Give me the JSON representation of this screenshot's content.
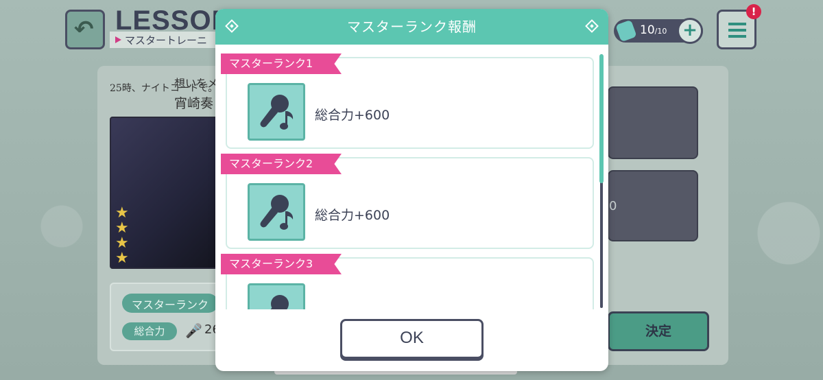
{
  "background": {
    "title": "LESSON",
    "subtitle": "マスタートレーニ",
    "stamina": {
      "current": "10",
      "max": "/10"
    },
    "menu_badge": "!",
    "card": {
      "unit_logo": "25時、ナイトコードで。",
      "title": "想いをメ",
      "character_name": "宵崎奏"
    },
    "master_rank_pill": "マスターランク",
    "power_pill": "総合力",
    "power_value": "26",
    "right_box_digit": "0",
    "decide_button": "決定"
  },
  "dialog": {
    "title": "マスターランク報酬",
    "items": [
      {
        "rank_label": "マスターランク1",
        "icon": "microphone-music-icon",
        "reward": "総合力+600"
      },
      {
        "rank_label": "マスターランク2",
        "icon": "microphone-music-icon",
        "reward": "総合力+600"
      },
      {
        "rank_label": "マスターランク3",
        "icon": "microphone-music-icon",
        "reward": ""
      }
    ],
    "ok_button": "OK"
  },
  "colors": {
    "header_teal": "#5cc6b1",
    "rank_tag_pink": "#e84c97",
    "icon_bg": "#8fd6ce",
    "text_dark": "#3c4256"
  }
}
